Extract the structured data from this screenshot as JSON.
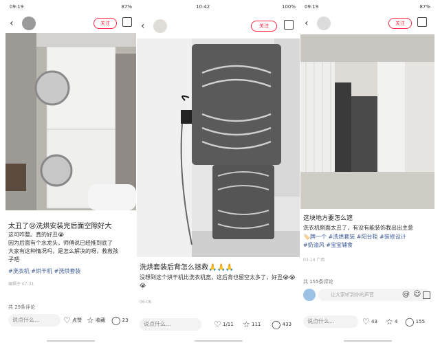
{
  "panel1": {
    "status_time": "09:19",
    "status_right": "87%",
    "follow_label": "关注",
    "title": "太丑了😢洗烘安装完后面空隙好大",
    "body_lines": [
      "这可咋整。真的好丑😭",
      "因为后面有个水龙头，师傅说已经推到底了",
      "大家有这种情况吗，是怎么解决的呀，救救孩",
      "子吧"
    ],
    "tags": "#洗衣机 #烘干机 #洗烘套装",
    "meta": "编辑于 07-31",
    "comments_count": "共 29条评论",
    "say_placeholder": "说点什么...",
    "like_label": "点赞",
    "collect_label": "收藏",
    "comment_count": "23"
  },
  "panel2": {
    "status_time": "10:42",
    "status_right": "100%",
    "follow_label": "关注",
    "title": "洗烘套装后背怎么拯救🙏🙏🙏",
    "body": "没想到这个烘干机比洗衣机宽，这后背也留空太多了，好丑😭😭😭",
    "meta": "06-06",
    "say_placeholder": "说点什么...",
    "like_count": "1/11",
    "collect_count": "111",
    "comment_count": "433"
  },
  "panel3": {
    "status_time": "09:19",
    "status_right": "87%",
    "follow_label": "关注",
    "title": "这块地方要怎么遮",
    "body": "洗衣机侧面太丑了，有没有能装饰我出出主意",
    "tags_line1": "🏷️牌一个 #洗烘套装 #阳台柜 #装修设计",
    "tags_line2": "#奶油风 #宝宝辅食",
    "meta": "03-14 广西",
    "comments_count": "共 155条评论",
    "comment_input_placeholder": "让大家听到你的声音",
    "say_placeholder": "说点什么...",
    "like_count": "43",
    "collect_count": "4",
    "comment_count": "155"
  },
  "icons": {
    "back": "chevron-left-icon",
    "share": "share-icon",
    "like": "heart-icon",
    "collect": "star-icon",
    "comment": "comment-icon"
  },
  "colors": {
    "accent": "#ff2442",
    "tag": "#3d5a99"
  }
}
